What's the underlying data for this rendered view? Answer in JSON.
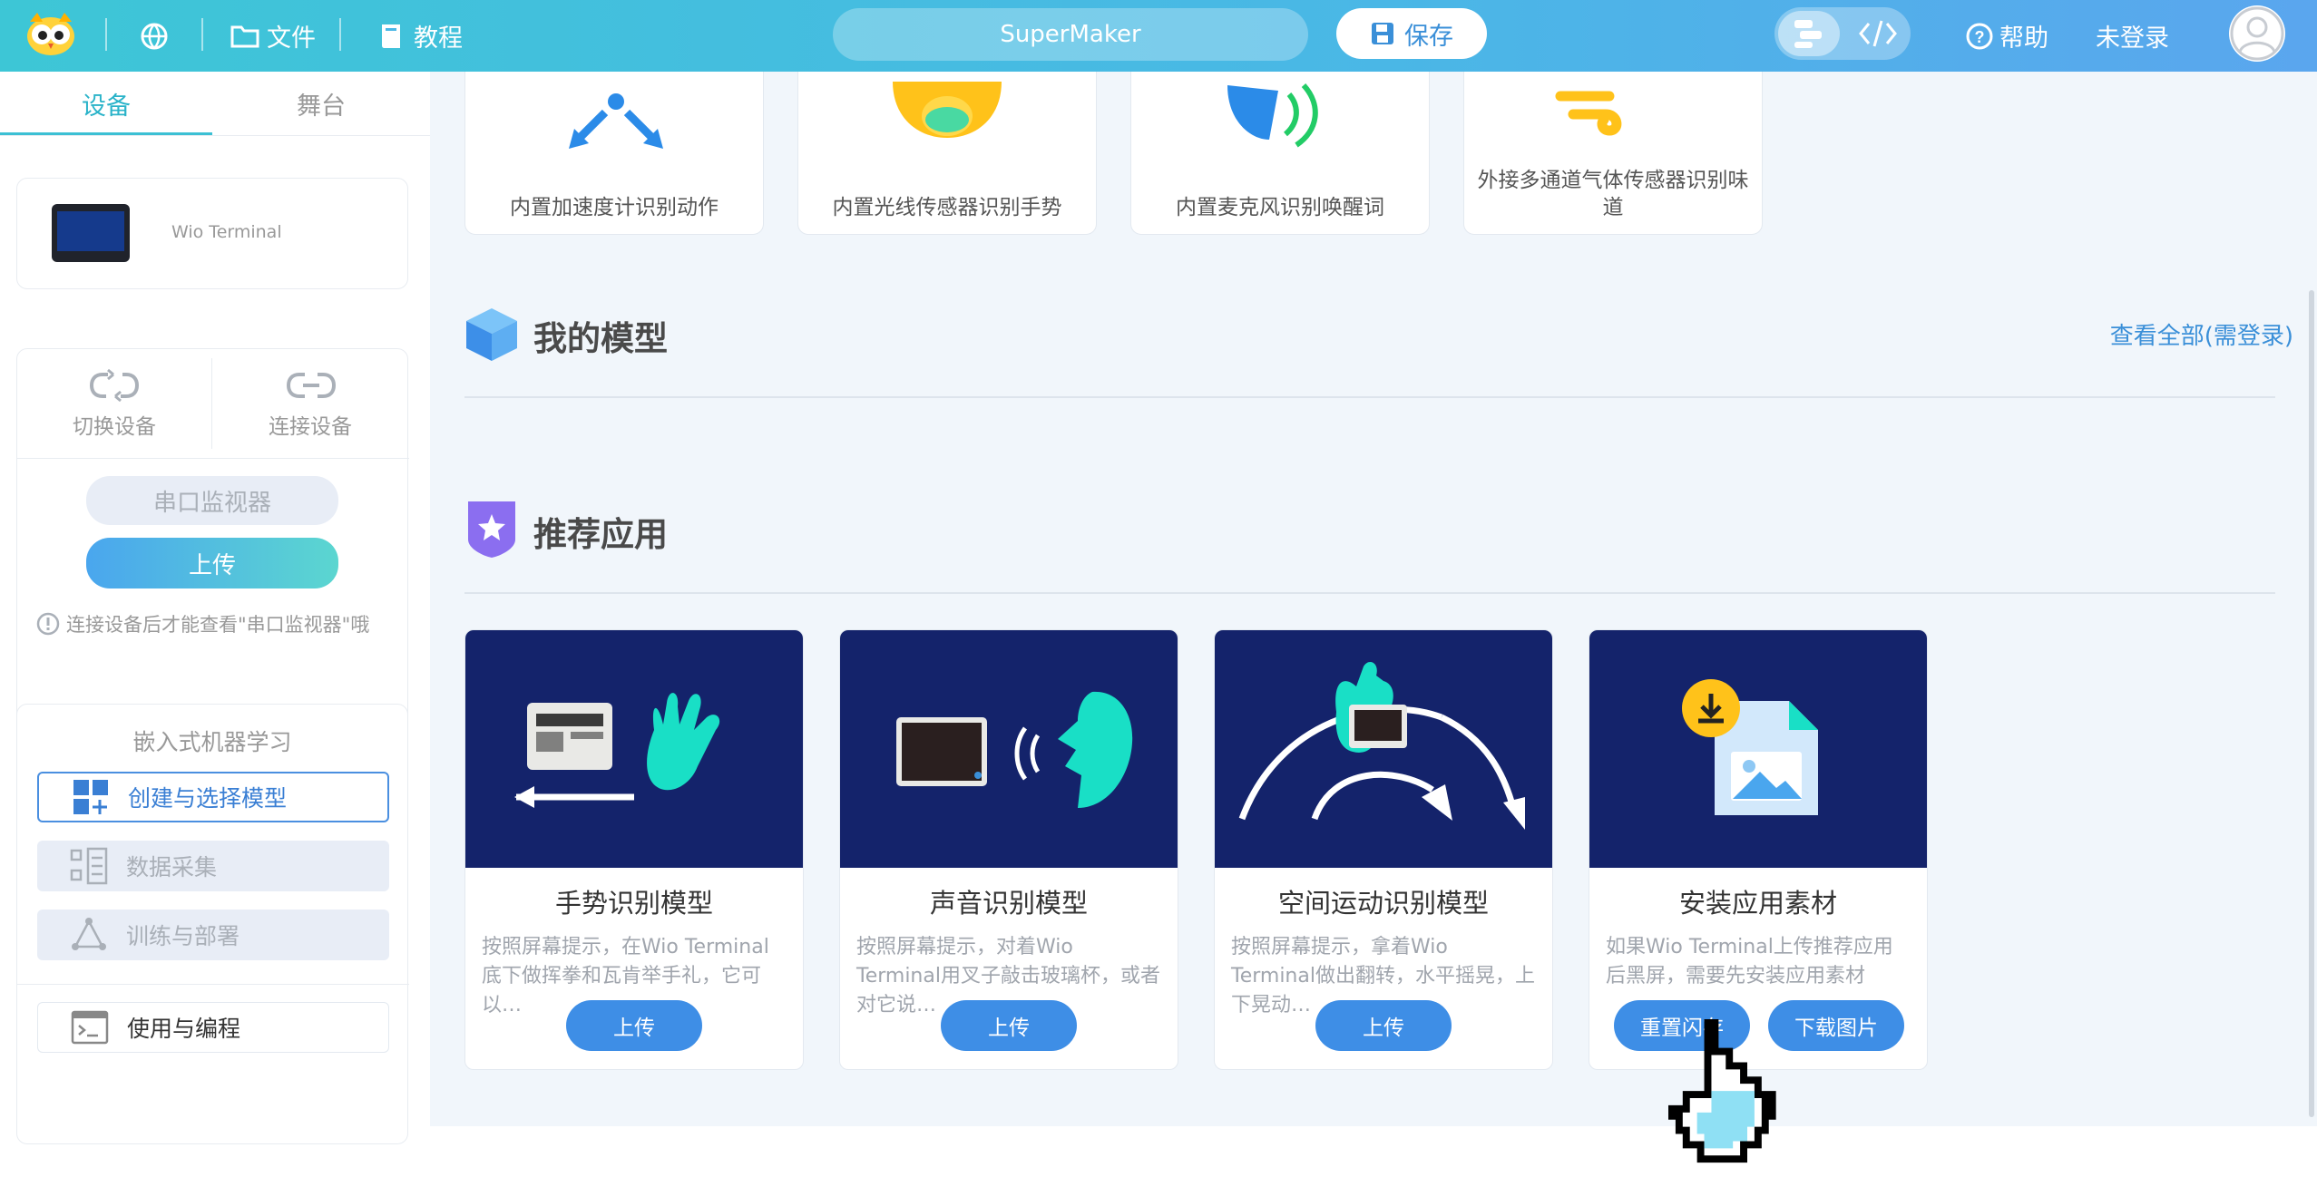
{
  "topbar": {
    "file_label": "文件",
    "tutorial_label": "教程",
    "project_name": "SuperMaker",
    "save_label": "保存",
    "help_label": "帮助",
    "login_label": "未登录"
  },
  "left": {
    "tabs": [
      "设备",
      "舞台"
    ],
    "device_name": "Wio Terminal",
    "switch_device": "切换设备",
    "connect_device": "连接设备",
    "serial_monitor": "串口监视器",
    "upload": "上传",
    "hint": "连接设备后才能查看\"串口监视器\"哦",
    "ml_title": "嵌入式机器学习",
    "menu": [
      "创建与选择模型",
      "数据采集",
      "训练与部署"
    ],
    "use_program": "使用与编程"
  },
  "main": {
    "demo_cards": [
      "内置加速度计识别动作",
      "内置光线传感器识别手势",
      "内置麦克风识别唤醒词",
      "外接多通道气体传感器识别味道"
    ],
    "my_models_title": "我的模型",
    "view_all": "查看全部(需登录)",
    "recommended_title": "推荐应用",
    "apps": [
      {
        "name": "手势识别模型",
        "desc": "按照屏幕提示，在Wio Terminal底下做挥拳和瓦肯举手礼，它可以…",
        "buttons": [
          "上传"
        ]
      },
      {
        "name": "声音识别模型",
        "desc": "按照屏幕提示，对着Wio Terminal用叉子敲击玻璃杯，或者对它说…",
        "buttons": [
          "上传"
        ]
      },
      {
        "name": "空间运动识别模型",
        "desc": "按照屏幕提示，拿着Wio Terminal做出翻转，水平摇晃，上下晃动…",
        "buttons": [
          "上传"
        ]
      },
      {
        "name": "安装应用素材",
        "desc": "如果Wio Terminal上传推荐应用后黑屏，需要先安装应用素材",
        "buttons": [
          "重置闪存",
          "下载图片"
        ]
      }
    ]
  },
  "colors": {
    "accent": "#3cc0d4",
    "primary_blue": "#3e8ee6",
    "hero_navy": "#14236b",
    "teal_figure": "#19dfc6"
  }
}
